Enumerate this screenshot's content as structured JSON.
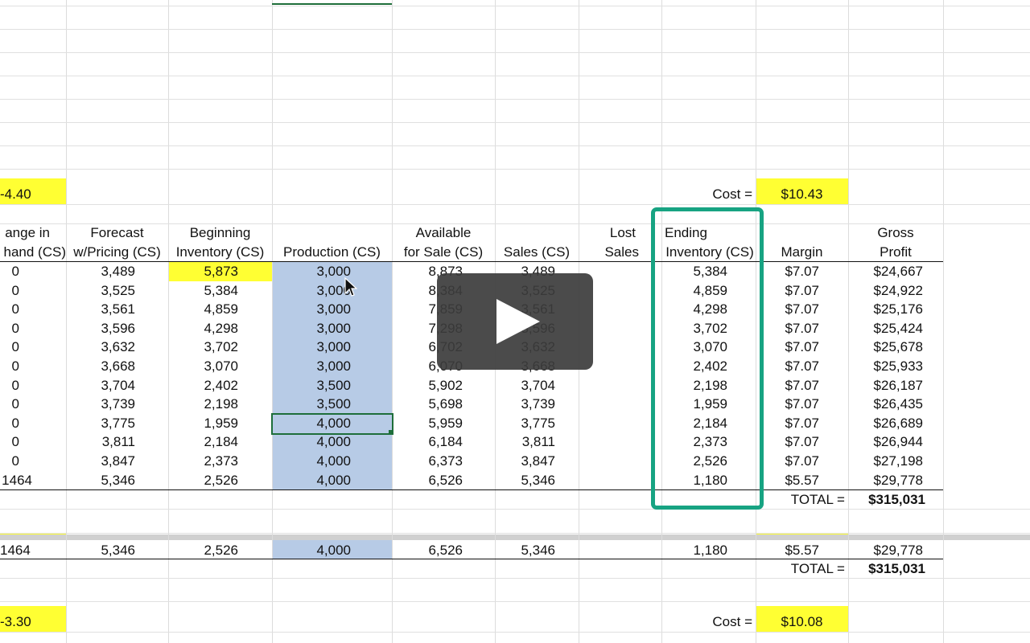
{
  "top_block": {
    "cell_a": "-4.40",
    "cost_label": "Cost =",
    "cost_value": "$10.43",
    "headers": {
      "col_a_l1": "ange in",
      "col_a_l2": "hand (CS)",
      "col_b_l1": "Forecast",
      "col_b_l2": "w/Pricing (CS)",
      "col_c_l1": "Beginning",
      "col_c_l2": "Inventory (CS)",
      "col_d_l2": "Production (CS)",
      "col_e_l1": "Available",
      "col_e_l2": "for Sale (CS)",
      "col_f_l2": "Sales (CS)",
      "col_g_l1": "Lost",
      "col_g_l2": "Sales",
      "col_h_l1": "Ending",
      "col_h_l2": "Inventory (CS)",
      "col_i_l2": "Margin",
      "col_j_l1": "Gross",
      "col_j_l2": "Profit"
    },
    "rows": [
      {
        "a": "0",
        "b": "3,489",
        "c": "5,873",
        "d": "3,000",
        "e": "8,873",
        "f": "3,489",
        "h": "5,384",
        "i": "$7.07",
        "j": "$24,667"
      },
      {
        "a": "0",
        "b": "3,525",
        "c": "5,384",
        "d": "3,000",
        "e": "8,384",
        "f": "3,525",
        "h": "4,859",
        "i": "$7.07",
        "j": "$24,922"
      },
      {
        "a": "0",
        "b": "3,561",
        "c": "4,859",
        "d": "3,000",
        "e": "7,859",
        "f": "3,561",
        "h": "4,298",
        "i": "$7.07",
        "j": "$25,176"
      },
      {
        "a": "0",
        "b": "3,596",
        "c": "4,298",
        "d": "3,000",
        "e": "7,298",
        "f": "3,596",
        "h": "3,702",
        "i": "$7.07",
        "j": "$25,424"
      },
      {
        "a": "0",
        "b": "3,632",
        "c": "3,702",
        "d": "3,000",
        "e": "6,702",
        "f": "3,632",
        "h": "3,070",
        "i": "$7.07",
        "j": "$25,678"
      },
      {
        "a": "0",
        "b": "3,668",
        "c": "3,070",
        "d": "3,000",
        "e": "6,070",
        "f": "3,668",
        "h": "2,402",
        "i": "$7.07",
        "j": "$25,933"
      },
      {
        "a": "0",
        "b": "3,704",
        "c": "2,402",
        "d": "3,500",
        "e": "5,902",
        "f": "3,704",
        "h": "2,198",
        "i": "$7.07",
        "j": "$26,187"
      },
      {
        "a": "0",
        "b": "3,739",
        "c": "2,198",
        "d": "3,500",
        "e": "5,698",
        "f": "3,739",
        "h": "1,959",
        "i": "$7.07",
        "j": "$26,435"
      },
      {
        "a": "0",
        "b": "3,775",
        "c": "1,959",
        "d": "4,000",
        "e": "5,959",
        "f": "3,775",
        "h": "2,184",
        "i": "$7.07",
        "j": "$26,689"
      },
      {
        "a": "0",
        "b": "3,811",
        "c": "2,184",
        "d": "4,000",
        "e": "6,184",
        "f": "3,811",
        "h": "2,373",
        "i": "$7.07",
        "j": "$26,944"
      },
      {
        "a": "0",
        "b": "3,847",
        "c": "2,373",
        "d": "4,000",
        "e": "6,373",
        "f": "3,847",
        "h": "2,526",
        "i": "$7.07",
        "j": "$27,198"
      },
      {
        "a": "1464",
        "b": "5,346",
        "c": "2,526",
        "d": "4,000",
        "e": "6,526",
        "f": "5,346",
        "h": "1,180",
        "i": "$5.57",
        "j": "$29,778"
      }
    ],
    "total_label": "TOTAL =",
    "total_value": "$315,031"
  },
  "bottom_block": {
    "row": {
      "a": "1464",
      "b": "5,346",
      "c": "2,526",
      "d": "4,000",
      "e": "6,526",
      "f": "5,346",
      "h": "1,180",
      "i": "$5.57",
      "j": "$29,778"
    },
    "total_label": "TOTAL =",
    "total_value": "$315,031",
    "cell_a": "-3.30",
    "cost_label": "Cost =",
    "cost_value": "$10.08"
  },
  "colors": {
    "highlight_yellow": "#ffff33",
    "production_blue": "#b7cbe6",
    "annotation_teal": "#17a382",
    "selection_green": "#1e6e3a"
  },
  "video_player": {
    "play_icon": "play-icon"
  }
}
